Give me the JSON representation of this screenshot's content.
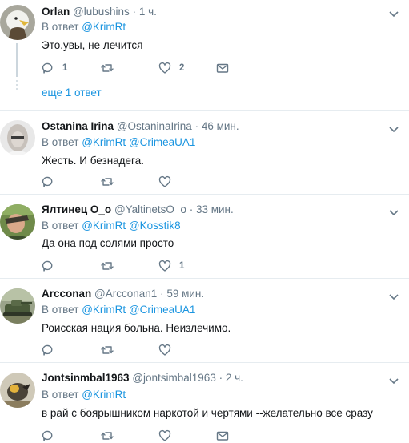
{
  "tweets": [
    {
      "name": "Orlan",
      "handle": "@lubushins",
      "time": "1 ч.",
      "reply_prefix": "В ответ",
      "mentions": [
        "@KrimRt"
      ],
      "text": "Это,увы, не лечится",
      "replies": "1",
      "retweets": "",
      "likes": "2",
      "avatar": "eagle"
    },
    {
      "name": "Ostanina Irina",
      "handle": "@OstaninaIrina",
      "time": "46 мин.",
      "reply_prefix": "В ответ",
      "mentions": [
        "@KrimRt",
        "@CrimeaUA1"
      ],
      "text": "Жесть. И безнадега.",
      "replies": "",
      "retweets": "",
      "likes": "",
      "avatar": "woman"
    },
    {
      "name": "Ялтинец О_о",
      "handle": "@YaltinetsO_o",
      "time": "33 мин.",
      "reply_prefix": "В ответ",
      "mentions": [
        "@KrimRt",
        "@Kosstik8"
      ],
      "text": "Да она под солями просто",
      "replies": "",
      "retweets": "",
      "likes": "1",
      "avatar": "man"
    },
    {
      "name": "Arcconan",
      "handle": "@Arcconan1",
      "time": "59 мин.",
      "reply_prefix": "В ответ",
      "mentions": [
        "@KrimRt",
        "@CrimeaUA1"
      ],
      "text": "Роисская нация больна. Неизлечимо.",
      "replies": "",
      "retweets": "",
      "likes": "",
      "avatar": "tank"
    },
    {
      "name": "Jontsinmbal1963",
      "handle": "@jontsimbal1963",
      "time": "2 ч.",
      "reply_prefix": "В ответ",
      "mentions": [
        "@KrimRt"
      ],
      "text": "в рай с боярышником наркотой и чертями --желательно  все сразу",
      "replies": "",
      "retweets": "",
      "likes": "",
      "avatar": "bird"
    }
  ],
  "thread": {
    "more_label": "еще 1 ответ"
  },
  "colors": {
    "link": "#1b95e0",
    "muted": "#657786",
    "divider": "#e6ecf0"
  }
}
